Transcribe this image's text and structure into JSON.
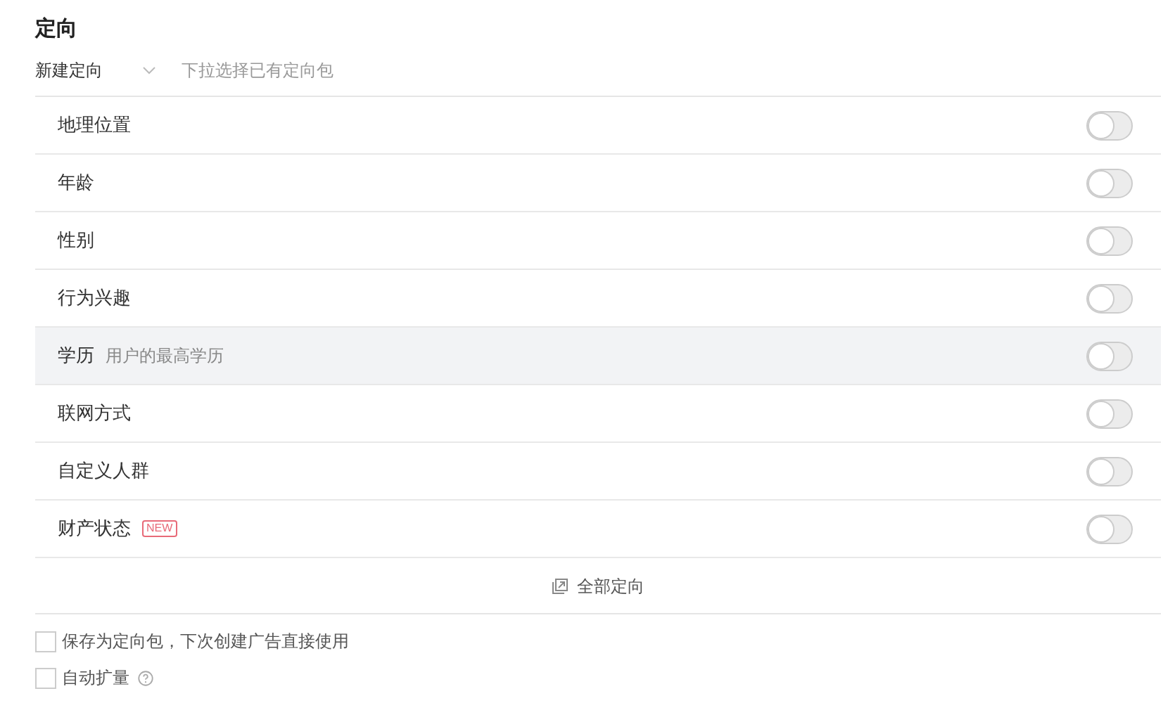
{
  "title": "定向",
  "type_select": {
    "value": "新建定向"
  },
  "package_select": {
    "placeholder": "下拉选择已有定向包"
  },
  "items": [
    {
      "label": "地理位置",
      "on": false,
      "highlighted": false
    },
    {
      "label": "年龄",
      "on": false,
      "highlighted": false
    },
    {
      "label": "性别",
      "on": false,
      "highlighted": false
    },
    {
      "label": "行为兴趣",
      "on": false,
      "highlighted": false
    },
    {
      "label": "学历",
      "hint": "用户的最高学历",
      "on": false,
      "highlighted": true
    },
    {
      "label": "联网方式",
      "on": false,
      "highlighted": false
    },
    {
      "label": "自定义人群",
      "on": false,
      "highlighted": false
    },
    {
      "label": "财产状态",
      "badge": "NEW",
      "on": false,
      "highlighted": false
    }
  ],
  "all_link": "全部定向",
  "options": [
    {
      "kind": "plain",
      "label": "保存为定向包，下次创建广告直接使用",
      "checked": false
    },
    {
      "kind": "help",
      "label": "自动扩量",
      "checked": false
    }
  ]
}
